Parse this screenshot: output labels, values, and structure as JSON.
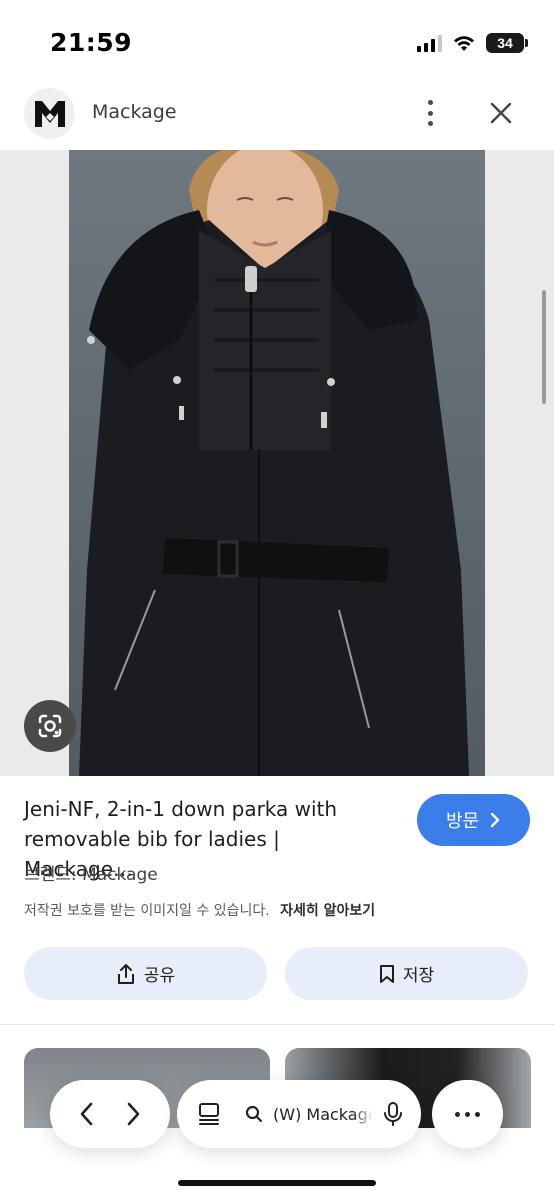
{
  "status_bar": {
    "time": "21:59",
    "battery": "34",
    "icons": [
      "cellular-signal-icon",
      "wifi-icon",
      "battery-icon"
    ]
  },
  "header": {
    "site_name": "Mackage",
    "logo_icon": "mackage-logo",
    "menu_icon": "more-vertical-icon",
    "close_icon": "close-icon"
  },
  "image": {
    "description_icon": "google-lens-icon"
  },
  "result": {
    "title": "Jeni-NF, 2-in-1 down parka with removable bib for ladies | Mackage…",
    "visit_label": "방문",
    "brand_line": "브랜드: Mackage",
    "copyright_note": "저작권 보호를 받는 이미지일 수 있습니다.",
    "learn_more": "자세히 알아보기"
  },
  "actions": {
    "share_label": "공유",
    "save_label": "저장"
  },
  "toolbar": {
    "back_icon": "chevron-left-icon",
    "forward_icon": "chevron-right-icon",
    "tabs_icon": "tabs-icon",
    "search_icon": "search-icon",
    "address_text": "(W) Mackage",
    "mic_icon": "mic-icon",
    "more_icon": "more-horizontal-icon"
  },
  "colors": {
    "accent": "#3b7de9",
    "action_bg": "#e8edfa"
  }
}
